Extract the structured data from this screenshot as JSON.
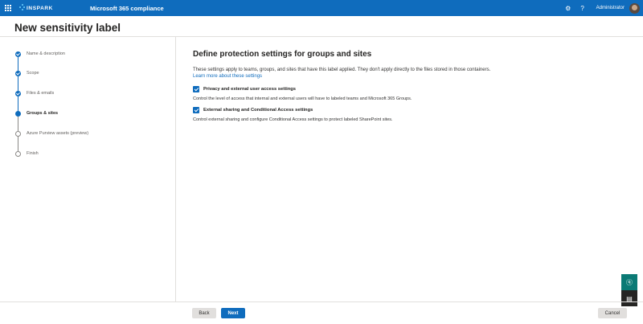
{
  "topbar": {
    "logo_text": "INSPARK",
    "app_title": "Microsoft 365 compliance",
    "user_name": "Administrator",
    "settings_icon": "gear-icon",
    "help_icon": "question-icon"
  },
  "page": {
    "title": "New sensitivity label"
  },
  "steps": [
    {
      "label": "Name & description",
      "state": "done"
    },
    {
      "label": "Scope",
      "state": "done"
    },
    {
      "label": "Files & emails",
      "state": "done"
    },
    {
      "label": "Groups & sites",
      "state": "current"
    },
    {
      "label": "Azure Purview assets (preview)",
      "state": "todo"
    },
    {
      "label": "Finish",
      "state": "todo"
    }
  ],
  "main": {
    "heading": "Define protection settings for groups and sites",
    "description": "These settings apply to teams, groups, and sites that have this label applied. They don't apply directly to the files stored in those containers.",
    "learn_more": "Learn more about these settings",
    "options": [
      {
        "label": "Privacy and external user access settings",
        "description": "Control the level of access that internal and external users will have to labeled teams and Microsoft 365 Groups.",
        "checked": true
      },
      {
        "label": "External sharing and Conditional Access settings",
        "description": "Control external sharing and configure Conditional Access settings to protect labeled SharePoint sites.",
        "checked": true
      }
    ]
  },
  "footer": {
    "back_label": "Back",
    "next_label": "Next",
    "cancel_label": "Cancel"
  },
  "colors": {
    "accent": "#0f6cbd",
    "help_fab": "#0b7a75",
    "chat_fab": "#252423"
  }
}
